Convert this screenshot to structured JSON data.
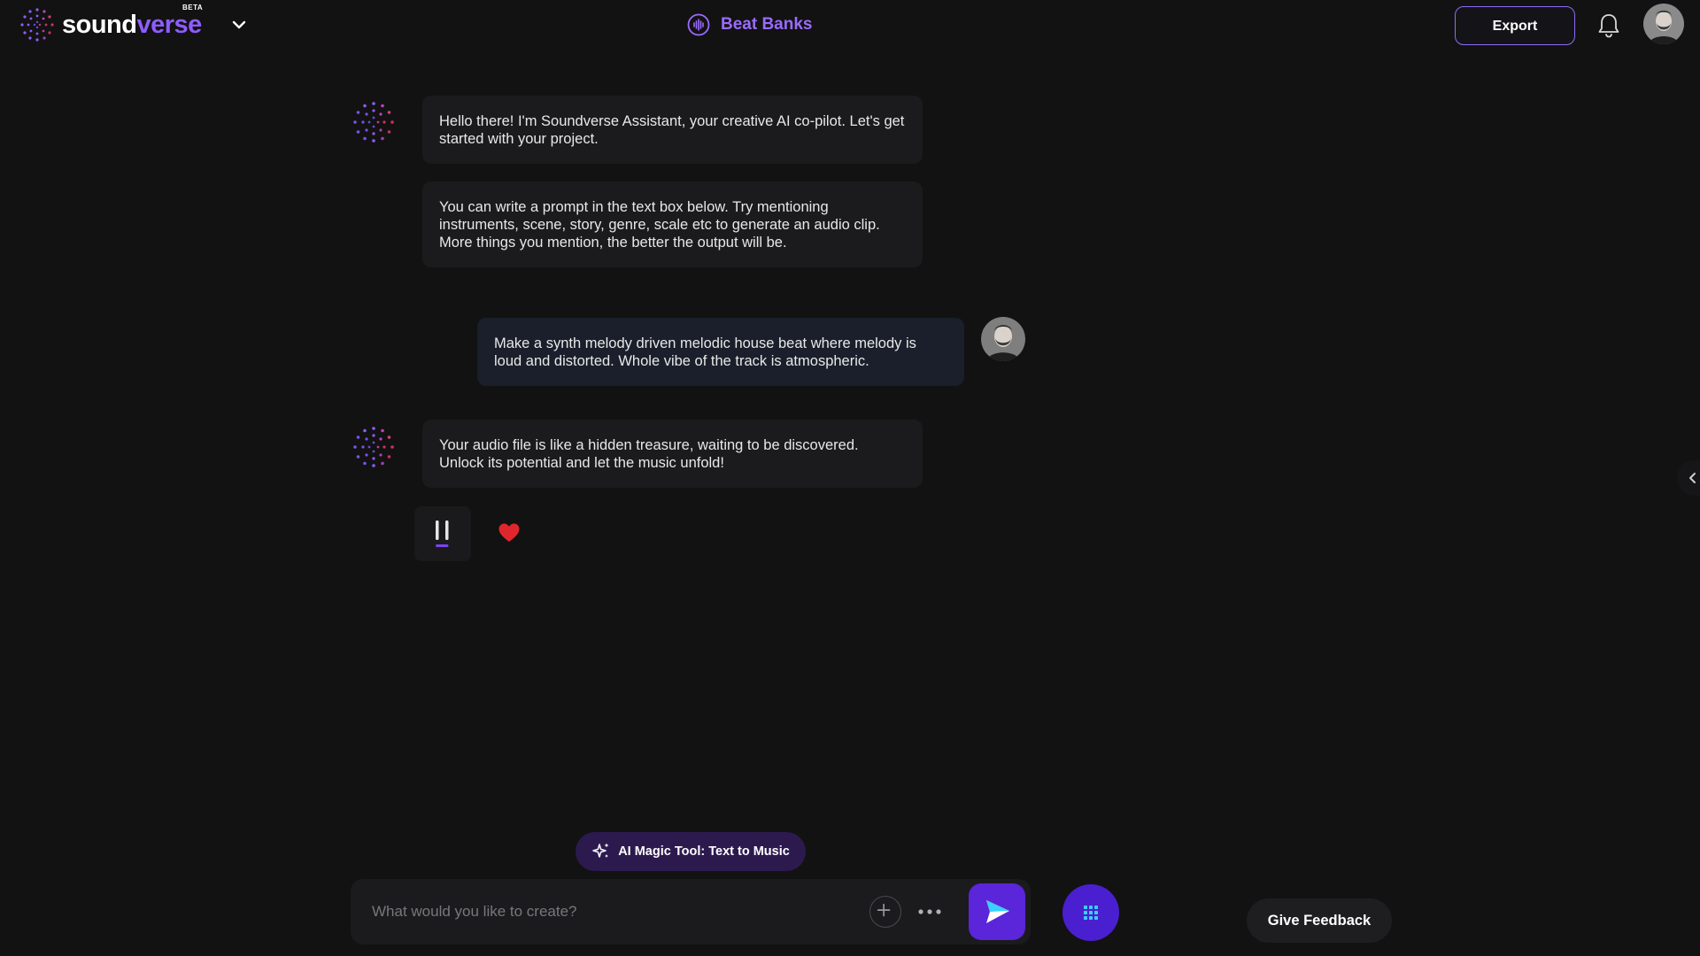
{
  "brand": {
    "name_part1": "sound",
    "name_part2": "verse",
    "badge": "BETA",
    "logo_icon": "dotted-sphere-logo",
    "caret_icon": "chevron-down-icon"
  },
  "header": {
    "title": "Beat Banks",
    "title_icon": "audio-wave-circle-icon",
    "export_label": "Export",
    "bell_icon": "bell-icon",
    "avatar_icon": "user-avatar"
  },
  "chat": {
    "messages": [
      {
        "sender": "assistant",
        "text": "Hello there! I'm Soundverse Assistant, your creative AI co-pilot. Let's get started with your project."
      },
      {
        "sender": "assistant",
        "text": "You can write a prompt in the text box below. Try mentioning instruments, scene, story, genre, scale etc to generate an audio clip. More things you mention, the better the output will be."
      },
      {
        "sender": "user",
        "text": "Make a synth melody driven melodic house beat where melody is loud and distorted. Whole vibe of the track is atmospheric."
      },
      {
        "sender": "assistant",
        "text": "Your audio file is like a hidden treasure, waiting to be discovered. Unlock its potential and let the music unfold!"
      }
    ],
    "audio_controls": {
      "pause_icon": "pause-icon",
      "like_icon": "heart-icon"
    }
  },
  "composer": {
    "magic_tool_label": "AI Magic Tool: Text to Music",
    "magic_icon": "sparkles-icon",
    "input_value": "",
    "input_placeholder": "What would you like to create?",
    "plus_icon": "plus-icon",
    "more_icon": "more-horizontal-icon",
    "send_icon": "send-icon",
    "grid_icon": "grid-icon"
  },
  "feedback_label": "Give Feedback",
  "colors": {
    "background": "#121212",
    "accent_purple": "#8e5cff",
    "send_button": "#5b25d9",
    "grid_button": "#4a1fd0",
    "heart": "#e0262d",
    "magic_pill": "#2c1a4f"
  }
}
